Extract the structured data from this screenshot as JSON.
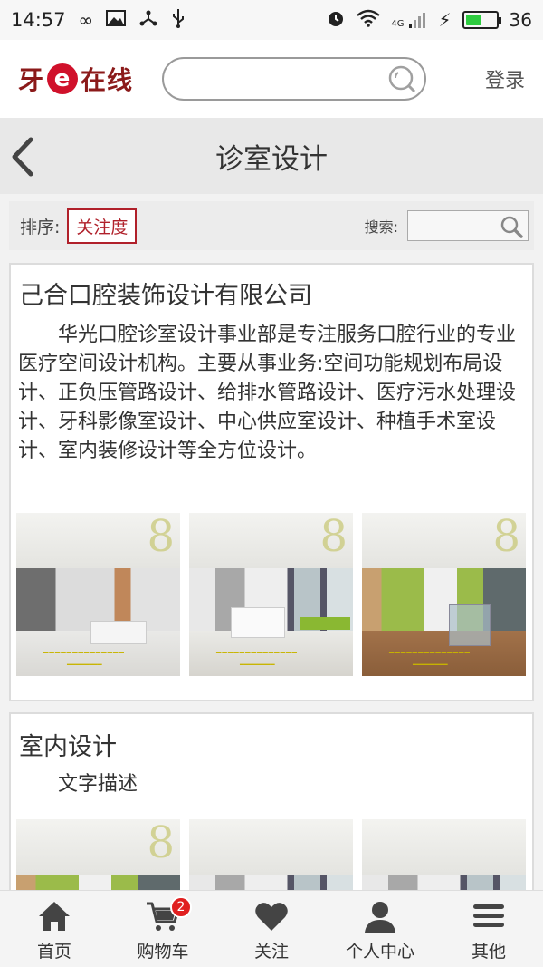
{
  "status_bar": {
    "time": "14:57",
    "network_label": "4G",
    "battery_level": "36",
    "icons": [
      "infinity-icon",
      "image-icon",
      "share-icon",
      "usb-icon",
      "alarm-icon",
      "wifi-icon",
      "signal-icon",
      "charging-icon",
      "battery-icon"
    ]
  },
  "header": {
    "logo_left": "牙",
    "logo_mid": "e",
    "logo_right": "在线",
    "search_placeholder": "",
    "login_label": "登录"
  },
  "titlebar": {
    "title": "诊室设计"
  },
  "filter": {
    "sort_label": "排序:",
    "sort_option": "关注度",
    "search_label": "搜索:",
    "search_placeholder": ""
  },
  "cards": [
    {
      "name": "己合口腔装饰设计有限公司",
      "description": "华光口腔诊室设计事业部是专注服务口腔行业的专业医疗空间设计机构。主要从事业务:空间功能规划布局设计、正负压管路设计、给排水管路设计、医疗污水处理设计、牙科影像室设计、中心供应室设计、种植手术室设计、室内装修设计等全方位设计。"
    },
    {
      "name": "室内设计",
      "description": "文字描述"
    }
  ],
  "bottom_nav": {
    "items": [
      {
        "label": "首页",
        "icon": "home-icon"
      },
      {
        "label": "购物车",
        "icon": "cart-icon",
        "badge": "2"
      },
      {
        "label": "关注",
        "icon": "heart-icon"
      },
      {
        "label": "个人中心",
        "icon": "user-icon"
      },
      {
        "label": "其他",
        "icon": "menu-icon"
      }
    ]
  },
  "colors": {
    "brand_red": "#d0112b",
    "accent_dark_red": "#b0202a",
    "badge_red": "#e02020"
  }
}
